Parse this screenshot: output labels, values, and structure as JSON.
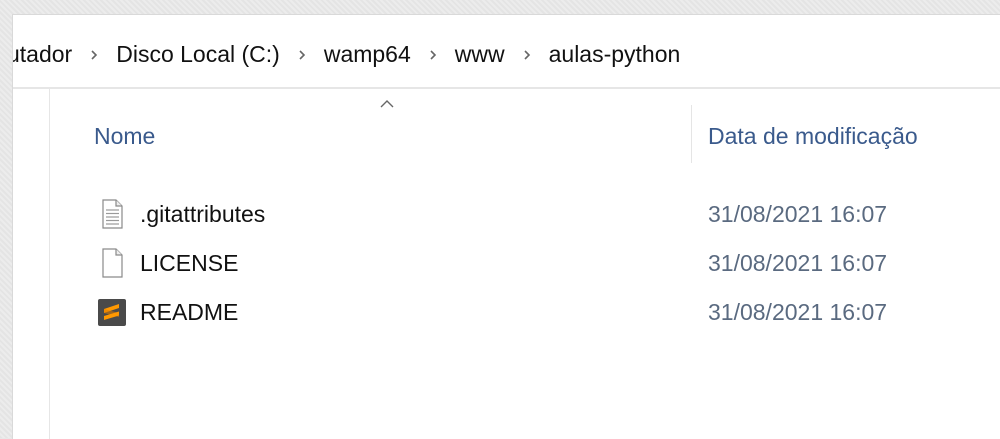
{
  "breadcrumb": {
    "items": [
      {
        "label": "utador"
      },
      {
        "label": "Disco Local (C:)"
      },
      {
        "label": "wamp64"
      },
      {
        "label": "www"
      },
      {
        "label": "aulas-python"
      }
    ],
    "separator_icon": "chevron-right-icon"
  },
  "columns": {
    "name": "Nome",
    "date_modified": "Data de modificação",
    "sort_indicator_icon": "sort-up-icon"
  },
  "files": [
    {
      "name": ".gitattributes",
      "date": "31/08/2021 16:07",
      "icon": "text-file-icon"
    },
    {
      "name": "LICENSE",
      "date": "31/08/2021 16:07",
      "icon": "blank-file-icon"
    },
    {
      "name": "README",
      "date": "31/08/2021 16:07",
      "icon": "sublime-text-icon"
    }
  ],
  "colors": {
    "header_text": "#3a5a8c",
    "date_text": "#5a6a80",
    "sublime_orange": "#ff9800",
    "sublime_bg": "#4a4a4a"
  }
}
